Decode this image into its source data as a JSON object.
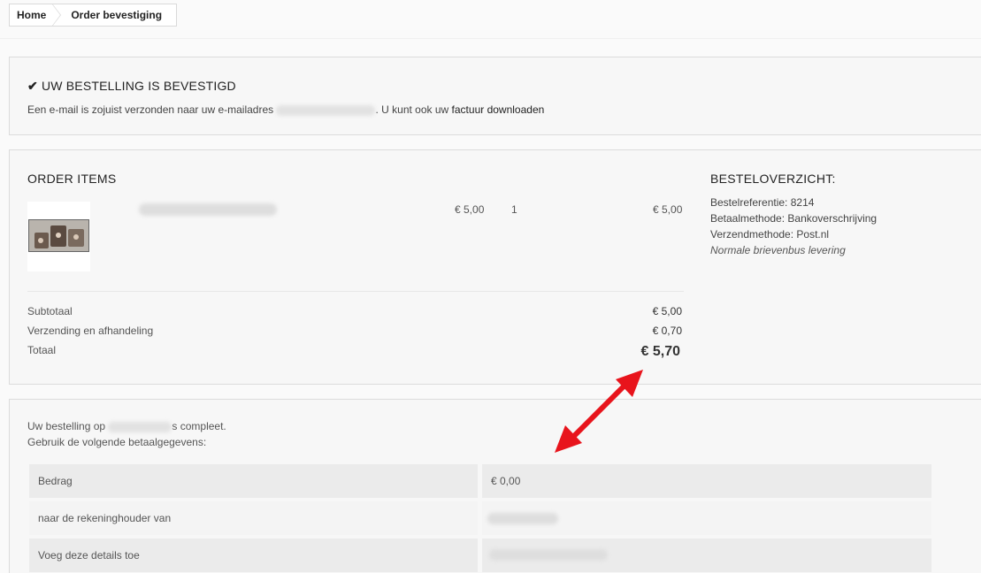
{
  "breadcrumb": {
    "home": "Home",
    "current": "Order bevestiging"
  },
  "confirmation": {
    "title": "UW BESTELLING IS BEVESTIGD",
    "text_before": "Een e-mail is zojuist verzonden naar uw e-mailadres",
    "text_after": ". U kunt ook uw",
    "invoice_link": "factuur downloaden"
  },
  "order": {
    "title": "ORDER ITEMS",
    "item": {
      "unit_price": "€ 5,00",
      "quantity": "1",
      "line_total": "€ 5,00"
    },
    "totals": {
      "subtotal_label": "Subtotaal",
      "subtotal_value": "€ 5,00",
      "shipping_label": "Verzending en afhandeling",
      "shipping_value": "€ 0,70",
      "total_label": "Totaal",
      "total_value": "€ 5,70"
    }
  },
  "summary": {
    "title": "BESTELOVERZICHT:",
    "reference": "Bestelreferentie: 8214",
    "payment_method": "Betaalmethode: Bankoverschrijving",
    "shipping_method": "Verzendmethode: Post.nl",
    "shipping_note": "Normale brievenbus levering"
  },
  "payment": {
    "line1_before": "Uw bestelling op",
    "line1_after": "s compleet.",
    "line2": "Gebruik de volgende betaalgegevens:",
    "rows": [
      {
        "label": "Bedrag",
        "value": "€ 0,00"
      },
      {
        "label": "naar de rekeninghouder van",
        "value": ""
      },
      {
        "label": "Voeg deze details toe",
        "value": ""
      }
    ]
  },
  "colors": {
    "annotation_arrow": "#e8141c"
  }
}
